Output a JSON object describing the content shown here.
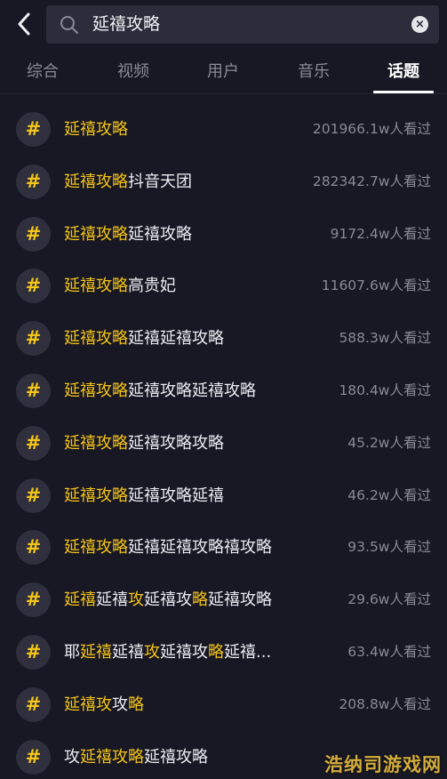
{
  "search": {
    "query": "延禧攻略"
  },
  "icons": {
    "back": "chevron-left-icon",
    "search": "search-icon",
    "clear": "clear-icon"
  },
  "tabs": [
    {
      "label": "综合",
      "active": false
    },
    {
      "label": "视频",
      "active": false
    },
    {
      "label": "用户",
      "active": false
    },
    {
      "label": "音乐",
      "active": false
    },
    {
      "label": "话题",
      "active": true
    }
  ],
  "colors": {
    "background": "#181824",
    "highlight": "#f4c419",
    "muted": "#8a8a98"
  },
  "topics": [
    {
      "segments": [
        {
          "t": "延禧攻略",
          "h": true
        }
      ],
      "views": "201966.1w人看过"
    },
    {
      "segments": [
        {
          "t": "延禧攻略",
          "h": true
        },
        {
          "t": "抖音天团",
          "h": false
        }
      ],
      "views": "282342.7w人看过"
    },
    {
      "segments": [
        {
          "t": "延禧攻略",
          "h": true
        },
        {
          "t": "延禧攻略",
          "h": false
        }
      ],
      "views": "9172.4w人看过"
    },
    {
      "segments": [
        {
          "t": "延禧攻略",
          "h": true
        },
        {
          "t": "高贵妃",
          "h": false
        }
      ],
      "views": "11607.6w人看过"
    },
    {
      "segments": [
        {
          "t": "延禧攻略",
          "h": true
        },
        {
          "t": "延禧延禧攻略",
          "h": false
        }
      ],
      "views": "588.3w人看过"
    },
    {
      "segments": [
        {
          "t": "延禧攻略",
          "h": true
        },
        {
          "t": "延禧攻略延禧攻略",
          "h": false
        }
      ],
      "views": "180.4w人看过"
    },
    {
      "segments": [
        {
          "t": "延禧攻略",
          "h": true
        },
        {
          "t": "延禧攻略攻略",
          "h": false
        }
      ],
      "views": "45.2w人看过"
    },
    {
      "segments": [
        {
          "t": "延禧攻略",
          "h": true
        },
        {
          "t": "延禧攻略延禧",
          "h": false
        }
      ],
      "views": "46.2w人看过"
    },
    {
      "segments": [
        {
          "t": "延禧攻略",
          "h": true
        },
        {
          "t": "延禧延禧攻略禧攻略",
          "h": false
        }
      ],
      "views": "93.5w人看过"
    },
    {
      "segments": [
        {
          "t": "延禧",
          "h": true
        },
        {
          "t": "延禧",
          "h": false
        },
        {
          "t": "攻",
          "h": true
        },
        {
          "t": "延禧攻",
          "h": false
        },
        {
          "t": "略",
          "h": true
        },
        {
          "t": "延禧攻略",
          "h": false
        }
      ],
      "views": "29.6w人看过"
    },
    {
      "segments": [
        {
          "t": "耶",
          "h": false
        },
        {
          "t": "延禧",
          "h": true
        },
        {
          "t": "延禧",
          "h": false
        },
        {
          "t": "攻",
          "h": true
        },
        {
          "t": "延禧攻",
          "h": false
        },
        {
          "t": "略",
          "h": true
        },
        {
          "t": "延禧...",
          "h": false
        }
      ],
      "views": "63.4w人看过"
    },
    {
      "segments": [
        {
          "t": "延禧攻",
          "h": true
        },
        {
          "t": "攻",
          "h": false
        },
        {
          "t": "略",
          "h": true
        }
      ],
      "views": "208.8w人看过"
    },
    {
      "segments": [
        {
          "t": "攻",
          "h": false
        },
        {
          "t": "延禧攻略",
          "h": true
        },
        {
          "t": "延禧攻略",
          "h": false
        }
      ],
      "views": ""
    }
  ],
  "hash_symbol": "#",
  "watermark": "浩纳司游戏网"
}
